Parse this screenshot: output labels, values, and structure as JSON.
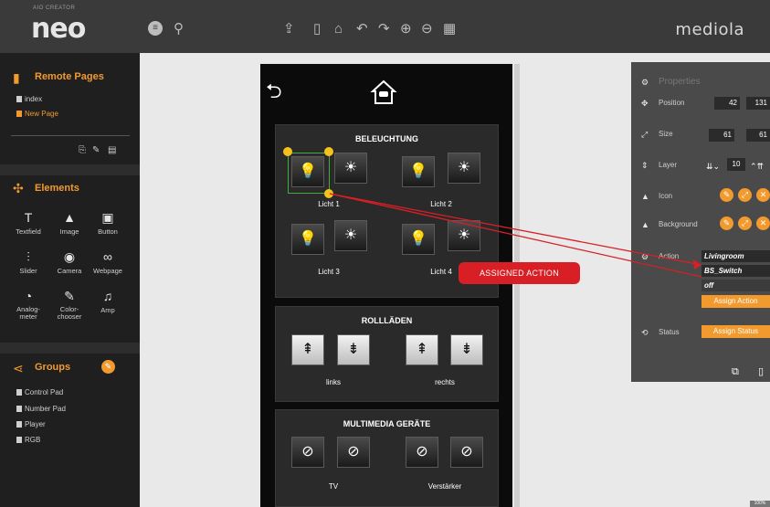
{
  "app": {
    "brand_small": "AIO CREATOR",
    "brand": "neo",
    "brand_right": "mediola"
  },
  "toolbar": {
    "icons": [
      "menu-icon",
      "pin-icon",
      "upload-icon",
      "phone-icon",
      "home-icon",
      "undo-icon",
      "redo-icon",
      "zoom-in-icon",
      "zoom-out-icon",
      "grid-icon"
    ]
  },
  "sidebar": {
    "remote_pages": {
      "title": "Remote Pages",
      "pages": [
        {
          "label": "index",
          "active": false
        },
        {
          "label": "New Page",
          "active": true
        }
      ]
    },
    "elements": {
      "title": "Elements",
      "items": [
        {
          "label": "Textfield",
          "icon": "textfield-icon"
        },
        {
          "label": "Image",
          "icon": "image-icon"
        },
        {
          "label": "Button",
          "icon": "button-icon"
        },
        {
          "label": "Slider",
          "icon": "slider-icon"
        },
        {
          "label": "Camera",
          "icon": "camera-icon"
        },
        {
          "label": "Webpage",
          "icon": "webpage-icon"
        },
        {
          "label": "Analog-\nmeter",
          "icon": "analog-meter-icon"
        },
        {
          "label": "Color-\nchooser",
          "icon": "color-chooser-icon"
        },
        {
          "label": "Amp",
          "icon": "amp-icon"
        }
      ]
    },
    "groups": {
      "title": "Groups",
      "items": [
        "Control Pad",
        "Number Pad",
        "Player",
        "RGB"
      ]
    }
  },
  "phone": {
    "sections": [
      {
        "title": "BELEUCHTUNG",
        "labels": [
          "Licht 1",
          "Licht 2",
          "Licht 3",
          "Licht 4"
        ]
      },
      {
        "title": "ROLLLÄDEN",
        "labels": [
          "links",
          "rechts"
        ]
      },
      {
        "title": "MULTIMEDIA GERÄTE",
        "labels": [
          "TV",
          "Verstärker"
        ]
      }
    ]
  },
  "properties": {
    "title": "Properties",
    "position_label": "Position",
    "position_x": "42",
    "position_y": "131",
    "size_label": "Size",
    "size_w": "61",
    "size_h": "61",
    "layer_label": "Layer",
    "layer_value": "10",
    "icon_label": "Icon",
    "background_label": "Background",
    "action_label": "Action",
    "action_room": "Livingroom",
    "action_device": "BS_Switch",
    "action_value": "off",
    "assign_action": "Assign Action",
    "status_label": "Status",
    "assign_status": "Assign Status"
  },
  "annotation": {
    "text": "ASSIGNED ACTION",
    "color": "#d81f26"
  },
  "colors": {
    "accent": "#f29a2e",
    "selection": "#3fae3f",
    "handle": "#f5c21d"
  },
  "zoom_tag": "100%"
}
